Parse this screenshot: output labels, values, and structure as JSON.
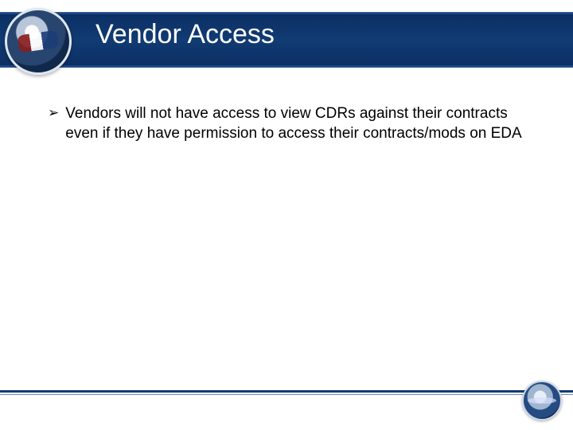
{
  "header": {
    "title": "Vendor Access"
  },
  "body": {
    "bullets": [
      {
        "glyph": "➢",
        "text": "Vendors will not have access to view CDRs against their contracts even if they have permission to access their contracts/mods on EDA"
      }
    ]
  },
  "footer": {
    "page_hint": ""
  },
  "assets": {
    "left_logo_name": "acquisition-directorate-seal",
    "right_crest_name": "dod-crest"
  },
  "colors": {
    "band_bg": "#113b73",
    "title_fg": "#ffffff",
    "rule": "#123a73"
  }
}
